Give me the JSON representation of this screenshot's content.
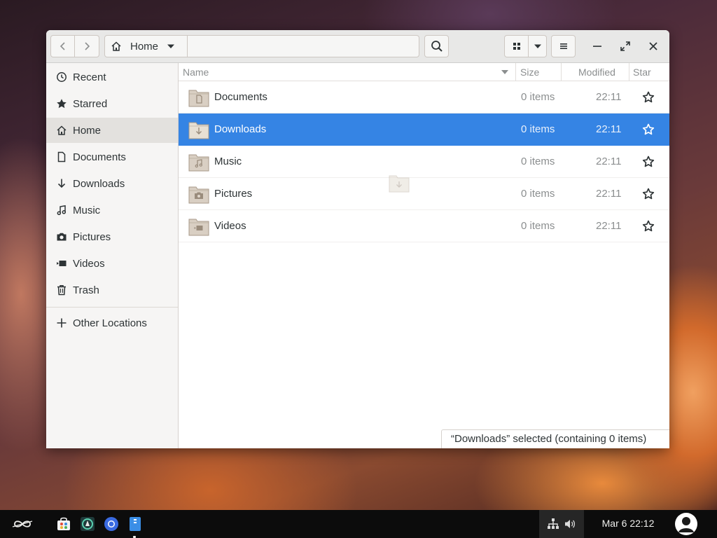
{
  "window": {
    "path_label": "Home",
    "search_placeholder": ""
  },
  "sidebar": {
    "items": [
      {
        "label": "Recent",
        "icon": "clock-icon"
      },
      {
        "label": "Starred",
        "icon": "star-icon"
      },
      {
        "label": "Home",
        "icon": "home-icon",
        "active": true
      },
      {
        "label": "Documents",
        "icon": "document-icon"
      },
      {
        "label": "Downloads",
        "icon": "download-icon"
      },
      {
        "label": "Music",
        "icon": "music-icon"
      },
      {
        "label": "Pictures",
        "icon": "camera-icon"
      },
      {
        "label": "Videos",
        "icon": "video-icon"
      },
      {
        "label": "Trash",
        "icon": "trash-icon"
      }
    ],
    "other_locations": "Other Locations"
  },
  "columns": {
    "name": "Name",
    "size": "Size",
    "modified": "Modified",
    "star": "Star"
  },
  "files": [
    {
      "name": "Documents",
      "size": "0 items",
      "modified": "22:11",
      "emblem": "document"
    },
    {
      "name": "Downloads",
      "size": "0 items",
      "modified": "22:11",
      "emblem": "download",
      "selected": true
    },
    {
      "name": "Music",
      "size": "0 items",
      "modified": "22:11",
      "emblem": "music"
    },
    {
      "name": "Pictures",
      "size": "0 items",
      "modified": "22:11",
      "emblem": "camera"
    },
    {
      "name": "Videos",
      "size": "0 items",
      "modified": "22:11",
      "emblem": "video"
    }
  ],
  "status": "“Downloads” selected  (containing 0 items)",
  "taskbar": {
    "clock": "Mar 6  22:12"
  },
  "colors": {
    "selection": "#3584e4",
    "folder": "#d9cfc3",
    "folder_border": "#a89a8a"
  }
}
